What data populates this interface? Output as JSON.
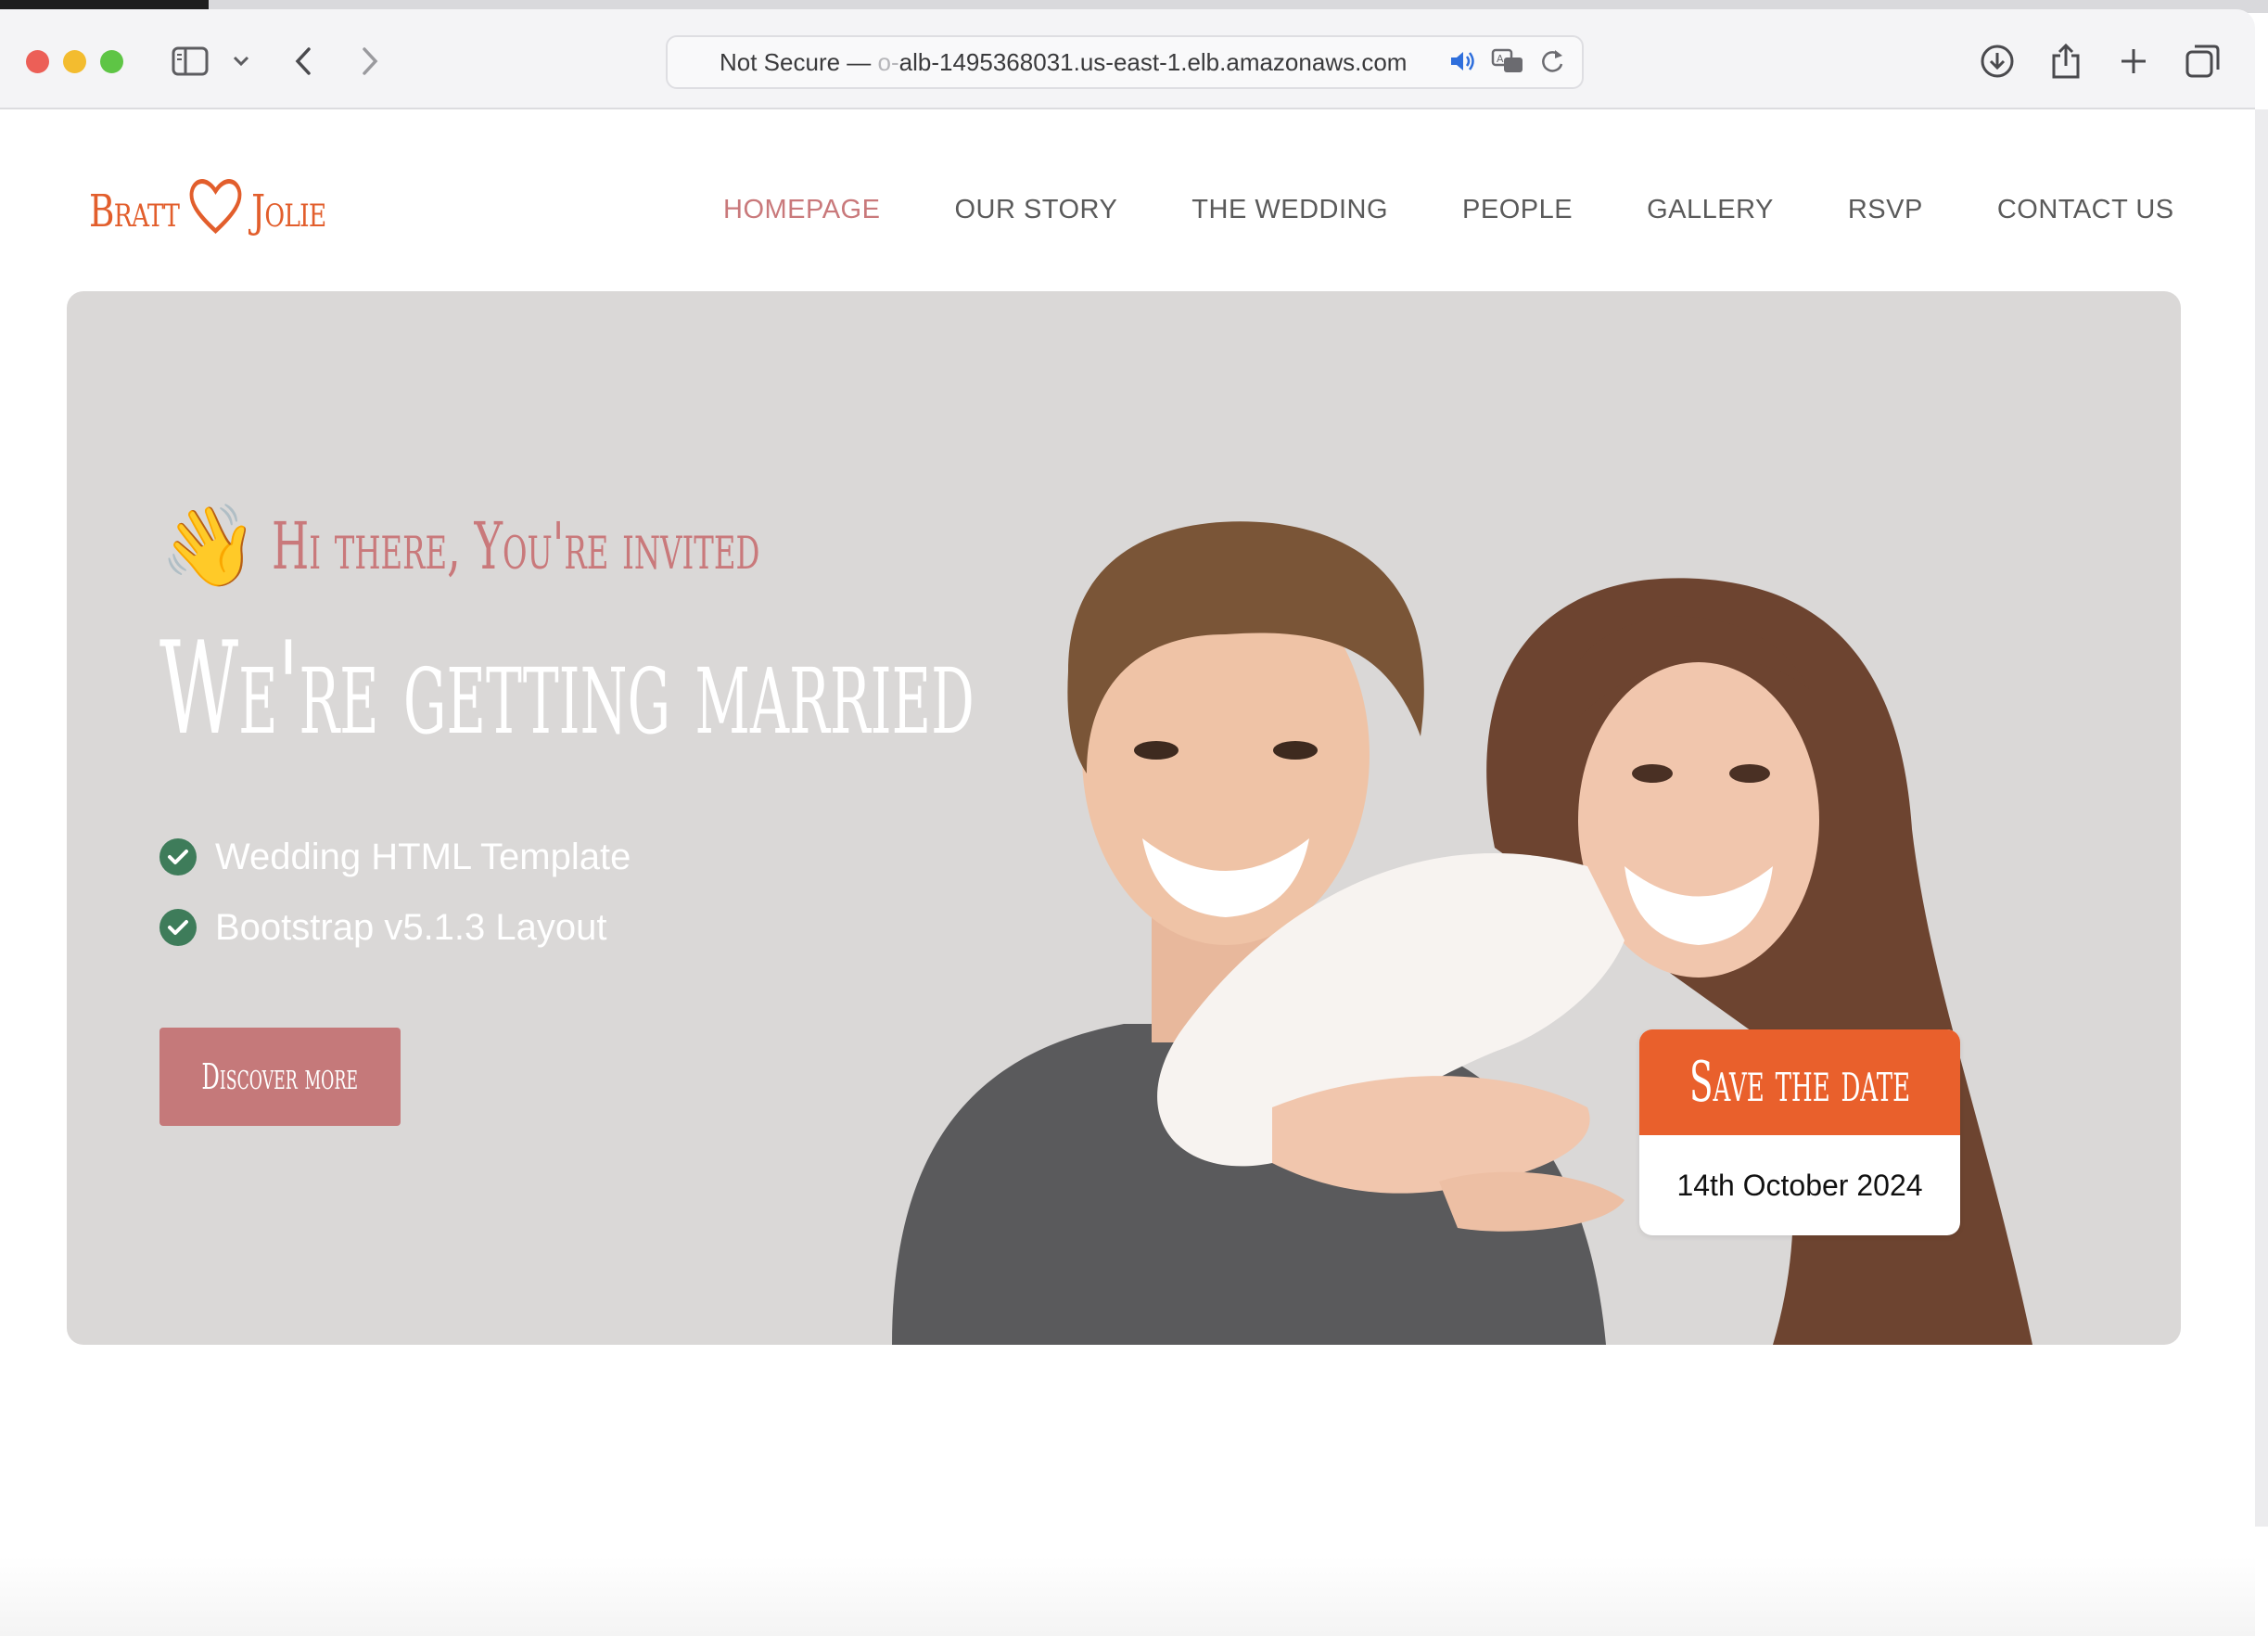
{
  "browser": {
    "url_prefix": "Not Secure —",
    "url_faded": "o-",
    "url_host": "alb-1495368031.us-east-1.elb.amazonaws.com"
  },
  "site": {
    "logo_left": "Bratt",
    "logo_right": "Jolie",
    "nav": [
      "HOMEPAGE",
      "OUR STORY",
      "THE WEDDING",
      "PEOPLE",
      "GALLERY",
      "RSVP",
      "CONTACT US"
    ],
    "active_nav": "HOMEPAGE"
  },
  "hero": {
    "wave_emoji": "👋",
    "greeting": "Hi there, You're invited",
    "headline": "We're getting married",
    "features": [
      "Wedding HTML Template",
      "Bootstrap v5.1.3 Layout"
    ],
    "cta": "Discover more",
    "save_title": "Save the date",
    "save_date": "14th October 2024"
  },
  "colors": {
    "accent": "#e25e2c",
    "rose": "#c9797b",
    "check": "#3e7c5a",
    "hero_bg": "#dad8d7"
  },
  "icons": [
    "sidebar-icon",
    "chevron-down-icon",
    "back-icon",
    "forward-icon",
    "speaker-icon",
    "translate-icon",
    "reload-icon",
    "download-icon",
    "share-icon",
    "plus-icon",
    "tabs-icon",
    "heart-icon",
    "check-icon"
  ]
}
